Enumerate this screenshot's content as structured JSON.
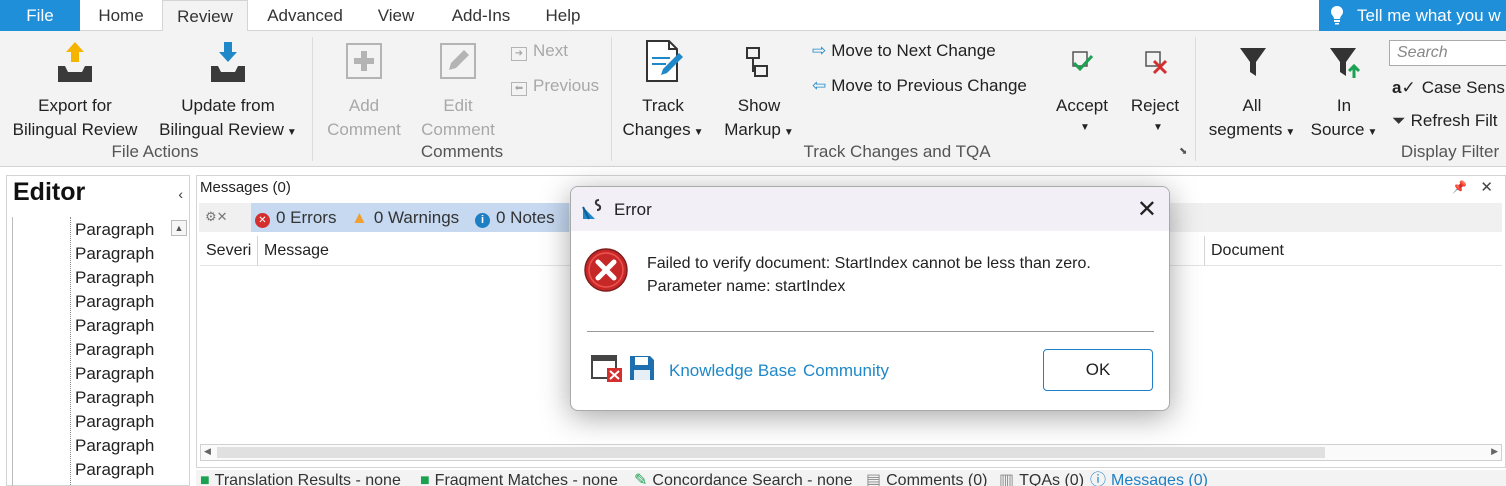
{
  "tabs": [
    "File",
    "Home",
    "Review",
    "Advanced",
    "View",
    "Add-Ins",
    "Help"
  ],
  "tell_me": "Tell me what you w",
  "ribbon": {
    "file_actions": {
      "export_line1": "Export for",
      "export_line2": "Bilingual Review",
      "update_line1": "Update from",
      "update_line2": "Bilingual Review",
      "label": "File Actions"
    },
    "comments": {
      "add_line1": "Add",
      "add_line2": "Comment",
      "edit_line1": "Edit",
      "edit_line2": "Comment",
      "next": "Next",
      "previous": "Previous",
      "label": "Comments"
    },
    "track_changes": {
      "track_line1": "Track",
      "track_line2": "Changes",
      "show_line1": "Show",
      "show_line2": "Markup",
      "move_next": "Move to Next Change",
      "move_previous": "Move to Previous Change",
      "accept": "Accept",
      "reject": "Reject",
      "label": "Track Changes and TQA"
    },
    "display_filter": {
      "all_line1": "All",
      "all_line2": "segments",
      "in_line1": "In",
      "in_line2": "Source",
      "search_placeholder": "Search",
      "case_sensitive": "Case Sensiti",
      "refresh_filter": "Refresh Filt",
      "label": "Display Filter"
    }
  },
  "editor": {
    "title": "Editor",
    "items": [
      "Paragraph",
      "Paragraph",
      "Paragraph",
      "Paragraph",
      "Paragraph",
      "Paragraph",
      "Paragraph",
      "Paragraph",
      "Paragraph",
      "Paragraph",
      "Paragraph"
    ]
  },
  "messages": {
    "title": "Messages (0)",
    "errors": "0 Errors",
    "warnings": "0 Warnings",
    "notes": "0 Notes",
    "columns": {
      "severity": "Severi",
      "message": "Message",
      "document": "Document"
    }
  },
  "bottom_tabs": [
    "Translation Results - none",
    "Fragment Matches - none",
    "Concordance Search - none",
    "Comments (0)",
    "TQAs (0)",
    "Messages (0)"
  ],
  "dialog": {
    "title": "Error",
    "message_line1": "Failed to verify document: StartIndex cannot be less than zero.",
    "message_line2": "Parameter name: startIndex",
    "link_kb": "Knowledge Base",
    "link_community": "Community",
    "ok": "OK"
  },
  "colors": {
    "accent": "#1e8fd8",
    "link": "#1e88c8",
    "error": "#d32f2f",
    "warning": "#f0a030",
    "info": "#1e7fc4"
  }
}
